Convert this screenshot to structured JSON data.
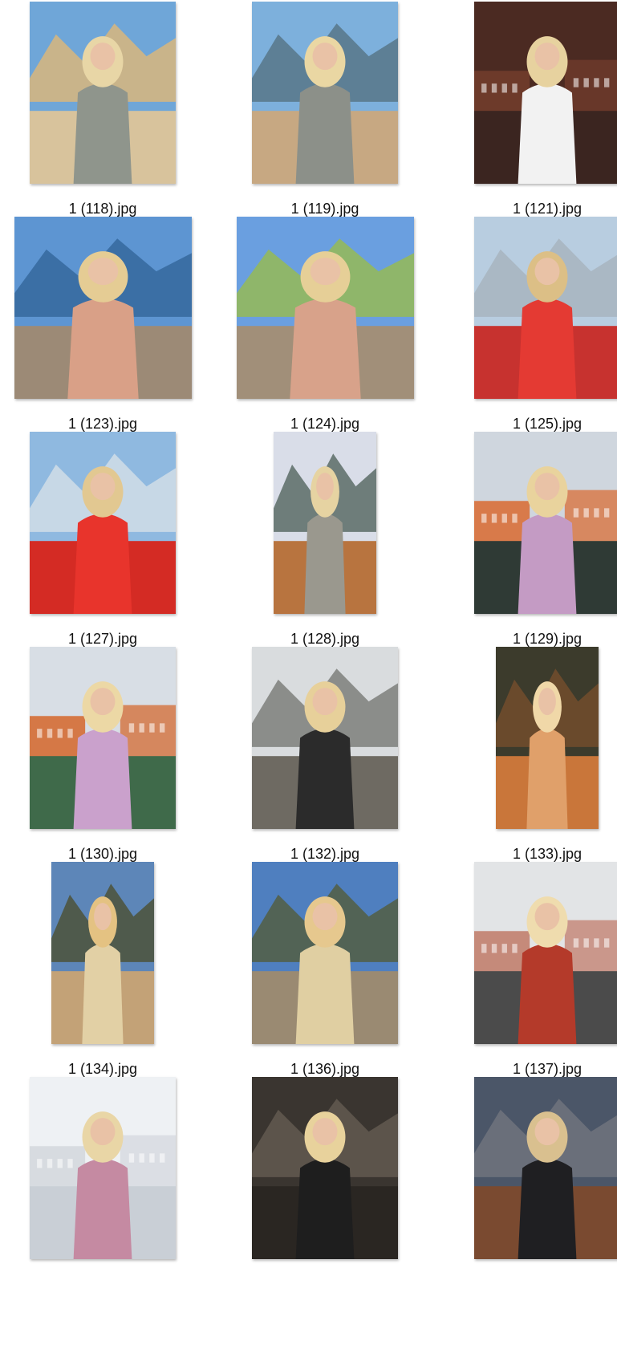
{
  "files": [
    {
      "name": "1 (118).jpg",
      "orientation": "portrait",
      "scene": "harbor-beach",
      "palette": {
        "sky": "#6fa6d8",
        "mid": "#c9b48a",
        "ground": "#d8c39c",
        "subject": "#8f958c",
        "hair": "#e8d6a6"
      }
    },
    {
      "name": "1 (119).jpg",
      "orientation": "portrait",
      "scene": "harbor-beach",
      "palette": {
        "sky": "#7db0dc",
        "mid": "#5d7f95",
        "ground": "#c7a882",
        "subject": "#8c9089",
        "hair": "#ead7a3"
      }
    },
    {
      "name": "1 (121).jpg",
      "orientation": "portrait",
      "scene": "surf-shop",
      "palette": {
        "sky": "#4b2a22",
        "mid": "#6d3a2a",
        "ground": "#3b2520",
        "subject": "#f2f2f2",
        "hair": "#e7d29f"
      }
    },
    {
      "name": "1 (123).jpg",
      "orientation": "landscape",
      "scene": "rocky-shore",
      "palette": {
        "sky": "#5d95d2",
        "mid": "#3b6fa5",
        "ground": "#9c8a76",
        "subject": "#d9a087",
        "hair": "#e5cc94"
      }
    },
    {
      "name": "1 (124).jpg",
      "orientation": "landscape",
      "scene": "rocky-shore",
      "palette": {
        "sky": "#6a9fe0",
        "mid": "#8fb66a",
        "ground": "#a18f79",
        "subject": "#d8a28a",
        "hair": "#e6cf97"
      }
    },
    {
      "name": "1 (125).jpg",
      "orientation": "portrait",
      "scene": "red-jacket",
      "palette": {
        "sky": "#b8cde0",
        "mid": "#aab8c4",
        "ground": "#c7322f",
        "subject": "#e43a33",
        "hair": "#dcbf86"
      }
    },
    {
      "name": "1 (127).jpg",
      "orientation": "portrait",
      "scene": "red-jacket",
      "palette": {
        "sky": "#8fb9e0",
        "mid": "#c7d8e6",
        "ground": "#d42b24",
        "subject": "#e8342c",
        "hair": "#e2c891"
      }
    },
    {
      "name": "1 (128).jpg",
      "orientation": "narrow",
      "scene": "mountain-balcony",
      "palette": {
        "sky": "#d9dde8",
        "mid": "#6e7d7a",
        "ground": "#b8743f",
        "subject": "#9a988e",
        "hair": "#e6d3a2"
      }
    },
    {
      "name": "1 (129).jpg",
      "orientation": "portrait",
      "scene": "colorful-houses",
      "palette": {
        "sky": "#cfd6de",
        "mid": "#d87a4a",
        "ground": "#2f3a35",
        "subject": "#c49bc4",
        "hair": "#e9d39d"
      }
    },
    {
      "name": "1 (130).jpg",
      "orientation": "portrait",
      "scene": "colorful-houses",
      "palette": {
        "sky": "#d8dee5",
        "mid": "#d57846",
        "ground": "#3f6a4a",
        "subject": "#caa1cc",
        "hair": "#ecd8a5"
      }
    },
    {
      "name": "1 (132).jpg",
      "orientation": "portrait",
      "scene": "misty-rocks",
      "palette": {
        "sky": "#d9dcde",
        "mid": "#8b8d8a",
        "ground": "#6e6a62",
        "subject": "#2b2b2b",
        "hair": "#e7d09a"
      }
    },
    {
      "name": "1 (133).jpg",
      "orientation": "narrow",
      "scene": "sunset-cap",
      "palette": {
        "sky": "#3c3b2c",
        "mid": "#6a4a2c",
        "ground": "#c9763a",
        "subject": "#e0a06a",
        "hair": "#f0d8a8"
      }
    },
    {
      "name": "1 (134).jpg",
      "orientation": "narrow",
      "scene": "city-view",
      "palette": {
        "sky": "#5d86b8",
        "mid": "#4f5a4c",
        "ground": "#c3a277",
        "subject": "#e2d0a5",
        "hair": "#e4c282"
      }
    },
    {
      "name": "1 (136).jpg",
      "orientation": "portrait",
      "scene": "city-view",
      "palette": {
        "sky": "#4f7fbf",
        "mid": "#526355",
        "ground": "#9a8a72",
        "subject": "#e0cfa2",
        "hair": "#e6c88e"
      }
    },
    {
      "name": "1 (137).jpg",
      "orientation": "portrait",
      "scene": "street-selfie",
      "palette": {
        "sky": "#e2e4e6",
        "mid": "#c58a7a",
        "ground": "#4b4b4b",
        "subject": "#b43a2a",
        "hair": "#efdcae"
      }
    },
    {
      "name": "",
      "orientation": "portrait",
      "scene": "window-wall",
      "palette": {
        "sky": "#eef1f4",
        "mid": "#d7dbe0",
        "ground": "#c9cfd6",
        "subject": "#c58aa2",
        "hair": "#e9d6a6"
      }
    },
    {
      "name": "",
      "orientation": "portrait",
      "scene": "dark-rocks",
      "palette": {
        "sky": "#3a3530",
        "mid": "#5c544b",
        "ground": "#2a2622",
        "subject": "#1e1e1e",
        "hair": "#e8d29c"
      }
    },
    {
      "name": "",
      "orientation": "portrait",
      "scene": "mountain-dusk",
      "palette": {
        "sky": "#4b5668",
        "mid": "#6a6f7a",
        "ground": "#7a4a30",
        "subject": "#1f1f22",
        "hair": "#d9c08f"
      }
    }
  ]
}
